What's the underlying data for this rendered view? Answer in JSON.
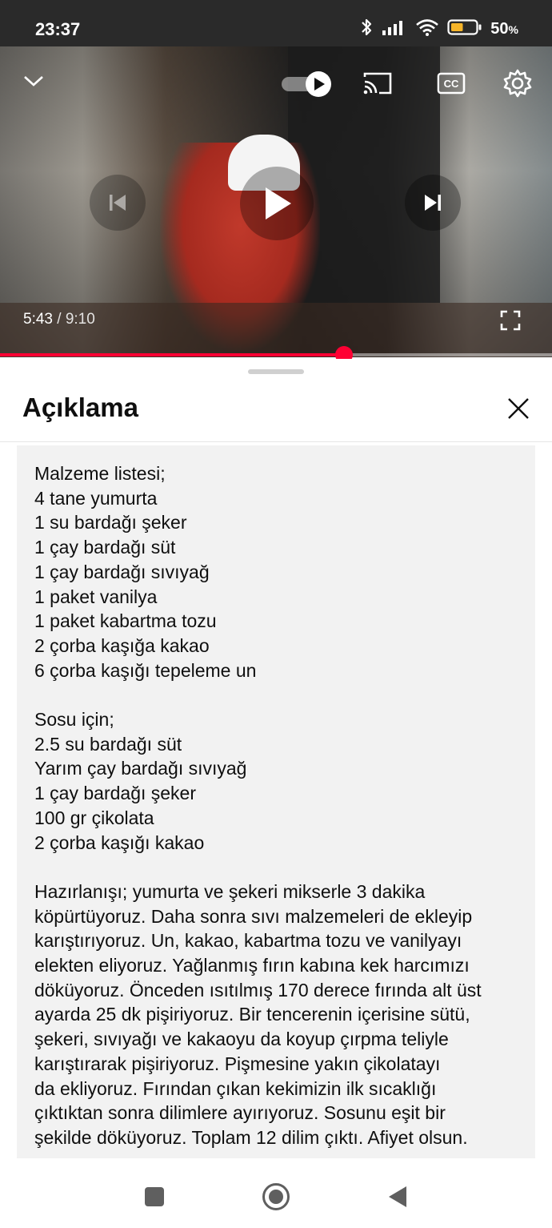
{
  "status_bar": {
    "time": "23:37",
    "battery_percent": "50",
    "battery_suffix": "%",
    "battery_level": 0.5,
    "icons": [
      "bluetooth-icon",
      "signal-icon",
      "wifi-icon",
      "battery-icon"
    ]
  },
  "player": {
    "current_time": "5:43",
    "separator": " / ",
    "duration": "9:10",
    "progress_fraction": 0.6236,
    "accent_color": "#ff0033",
    "icons": [
      "collapse-icon",
      "autoplay-toggle-icon",
      "cast-icon",
      "captions-icon",
      "settings-icon",
      "previous-icon",
      "play-icon",
      "next-icon",
      "fullscreen-icon"
    ]
  },
  "description_sheet": {
    "title": "Açıklama",
    "ingredients": [
      "Malzeme listesi;",
      "4 tane yumurta",
      "1 su bardağı şeker",
      "1 çay bardağı süt",
      "1 çay bardağı sıvıyağ",
      "1 paket vanilya",
      "1 paket kabartma tozu",
      "2 çorba kaşığa kakao",
      "6 çorba kaşığı tepeleme un"
    ],
    "sauce": [
      "Sosu için;",
      "2.5 su bardağı süt",
      "Yarım çay bardağı sıvıyağ",
      "1 çay bardağı şeker",
      "100 gr çikolata",
      "2 çorba kaşığı kakao"
    ],
    "preparation": [
      "Hazırlanışı; yumurta ve şekeri mikserle 3 dakika",
      "köpürtüyoruz. Daha sonra sıvı malzemeleri de ekleyip",
      "karıştırıyoruz. Un, kakao, kabartma tozu ve vanilyayı",
      "elekten eliyoruz. Yağlanmış fırın kabına kek harcımızı",
      "döküyoruz. Önceden ısıtılmış 170 derece fırında alt üst",
      "ayarda 25 dk pişiriyoruz. Bir tencerenin içerisine sütü,",
      "şekeri, sıvıyağı ve kakaoyu da koyup çırpma teliyle",
      "karıştırarak pişiriyoruz. Pişmesine yakın çikolatayı",
      "da ekliyoruz. Fırından çıkan kekimizin ilk sıcaklığı",
      "çıktıktan sonra dilimlere ayırıyoruz. Sosunu eşit bir",
      "şekilde döküyoruz. Toplam 12 dilim çıktı. Afiyet olsun."
    ]
  },
  "nav_bar": {
    "icons": [
      "recents-icon",
      "home-icon",
      "back-icon"
    ]
  }
}
